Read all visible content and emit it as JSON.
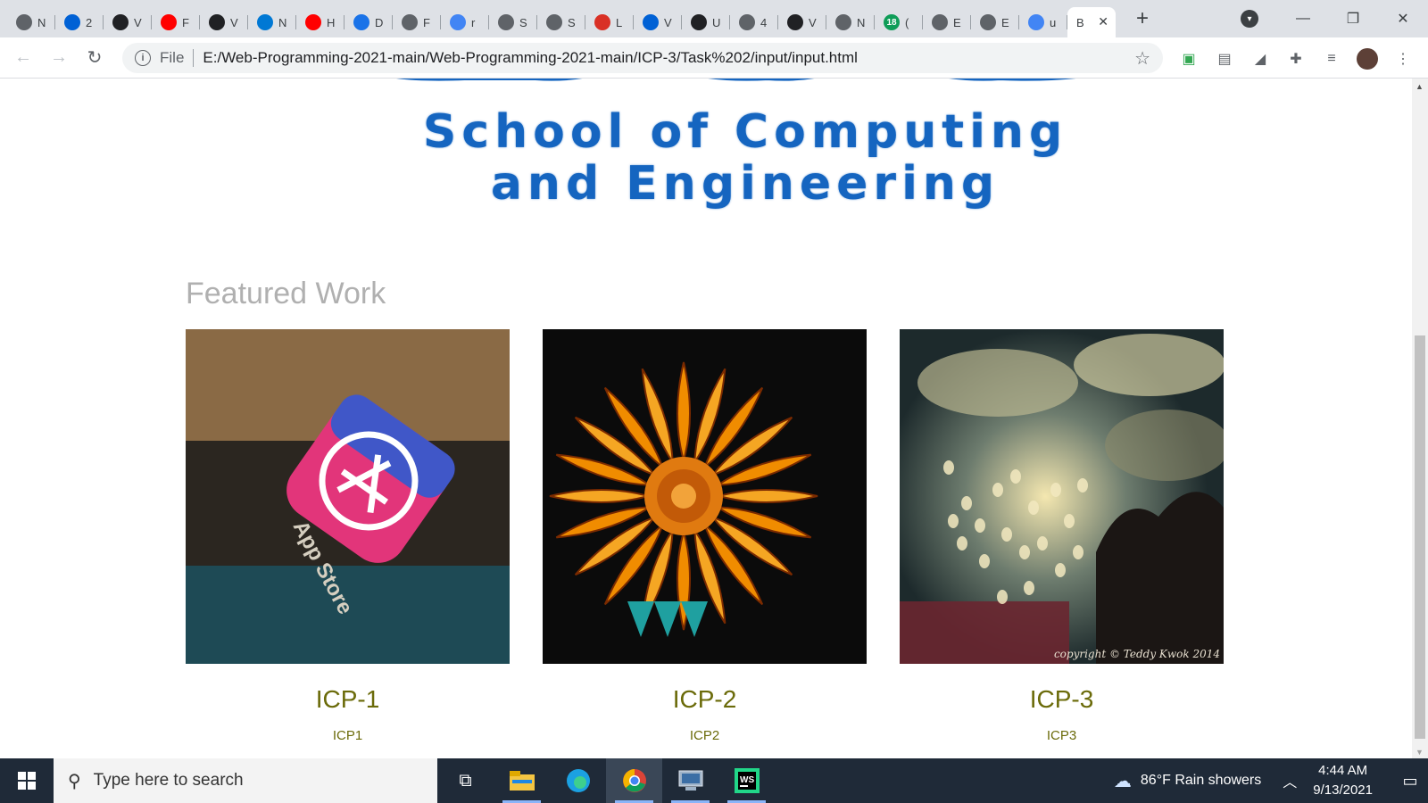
{
  "browser": {
    "tabs": [
      {
        "letter": "N",
        "icon": "chrome-icon",
        "color": "#5f6368"
      },
      {
        "letter": "2",
        "icon": "box-icon",
        "color": "#0061d5"
      },
      {
        "letter": "V",
        "icon": "github-icon",
        "color": "#202124"
      },
      {
        "letter": "F",
        "icon": "youtube-icon",
        "color": "#ff0000"
      },
      {
        "letter": "V",
        "icon": "github-icon",
        "color": "#202124"
      },
      {
        "letter": "N",
        "icon": "outlook-icon",
        "color": "#0078d4"
      },
      {
        "letter": "H",
        "icon": "youtube-icon",
        "color": "#ff0000"
      },
      {
        "letter": "D",
        "icon": "download-icon",
        "color": "#1a73e8"
      },
      {
        "letter": "F",
        "icon": "globe-icon",
        "color": "#5f6368"
      },
      {
        "letter": "r",
        "icon": "google-icon",
        "color": "#4285f4"
      },
      {
        "letter": "S",
        "icon": "cube-icon",
        "color": "#5f6368"
      },
      {
        "letter": "S",
        "icon": "cube-icon",
        "color": "#5f6368"
      },
      {
        "letter": "L",
        "icon": "burst-icon",
        "color": "#d93025"
      },
      {
        "letter": "V",
        "icon": "box-icon",
        "color": "#0061d5"
      },
      {
        "letter": "U",
        "icon": "github-icon",
        "color": "#202124"
      },
      {
        "letter": "4",
        "icon": "globe-icon",
        "color": "#5f6368"
      },
      {
        "letter": "V",
        "icon": "github-icon",
        "color": "#202124"
      },
      {
        "letter": "N",
        "icon": "chrome-icon",
        "color": "#5f6368"
      },
      {
        "letter": "(",
        "icon": "badge-18-icon",
        "color": "#0f9d58"
      },
      {
        "letter": "E",
        "icon": "globe-icon",
        "color": "#5f6368"
      },
      {
        "letter": "E",
        "icon": "globe-icon",
        "color": "#5f6368"
      },
      {
        "letter": "u",
        "icon": "google-icon",
        "color": "#4285f4"
      }
    ],
    "active_tab": {
      "letter": "B",
      "close": "✕"
    },
    "new_tab": "+",
    "window_controls": {
      "minimize": "—",
      "restore": "❐",
      "close": "✕"
    },
    "address": {
      "scheme": "File",
      "url": "E:/Web-Programming-2021-main/Web-Programming-2021-main/ICP-3/Task%202/input/input.html"
    }
  },
  "page": {
    "banner_line1": "School of Computing",
    "banner_line2": "and Engineering",
    "featured_heading": "Featured Work",
    "cards": [
      {
        "title": "ICP-1",
        "subtitle": "ICP1",
        "image": "app-store-photo"
      },
      {
        "title": "ICP-2",
        "subtitle": "ICP2",
        "image": "flower-photo",
        "caption": ""
      },
      {
        "title": "ICP-3",
        "subtitle": "ICP3",
        "image": "bokeh-night-photo",
        "watermark": "copyright © Teddy Kwok 2014"
      }
    ]
  },
  "taskbar": {
    "search_placeholder": "Type here to search",
    "weather": "86°F  Rain showers",
    "time": "4:44 AM",
    "date": "9/13/2021",
    "apps": [
      "task-view-icon",
      "file-explorer-icon",
      "edge-icon",
      "chrome-icon",
      "computer-icon",
      "webstorm-icon"
    ]
  },
  "colors": {
    "banner_text": "#1565c0",
    "card_text": "#6b6b0a",
    "featured_heading": "#b0b0b0",
    "taskbar_bg": "#1f2a38"
  }
}
